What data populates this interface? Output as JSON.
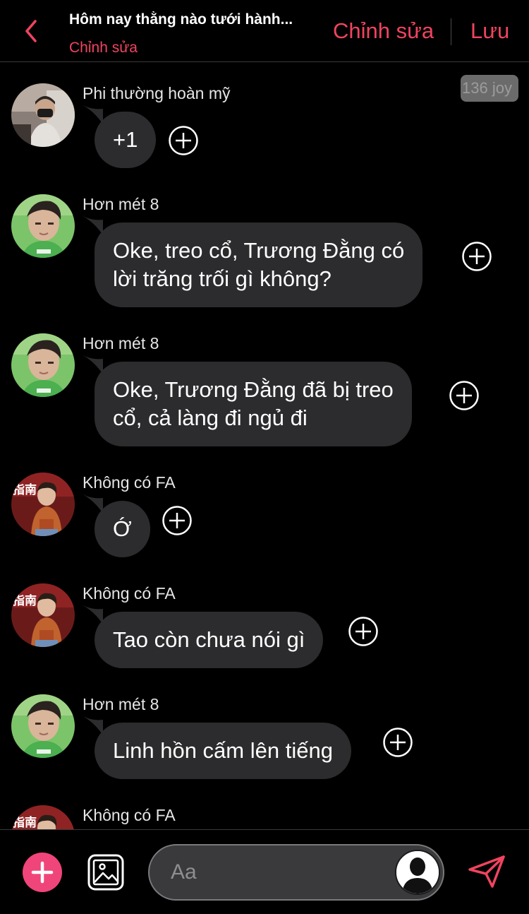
{
  "header": {
    "title": "Hôm nay thằng nào tưới hành...",
    "subtitle": "Chỉnh sửa",
    "edit_label": "Chỉnh sửa",
    "save_label": "Lưu",
    "back_icon": "chevron-left-icon"
  },
  "badge": "136 joy",
  "messages": [
    {
      "sender": "Phi thường hoàn mỹ",
      "lines": [
        "+1"
      ]
    },
    {
      "sender": "Hơn mét 8",
      "lines": [
        "Oke, treo cổ, Trương Đằng có",
        "lời trăng trối gì không?"
      ]
    },
    {
      "sender": "Hơn mét 8",
      "lines": [
        "Oke, Trương Đằng đã bị treo",
        "cổ, cả làng đi ngủ đi"
      ]
    },
    {
      "sender": "Không có FA",
      "lines": [
        "Ớ"
      ]
    },
    {
      "sender": "Không có FA",
      "lines": [
        "Tao còn chưa nói gì"
      ]
    },
    {
      "sender": "Hơn mét 8",
      "lines": [
        "Linh hồn cấm lên tiếng"
      ]
    },
    {
      "sender": "Không có FA",
      "lines": []
    }
  ],
  "input": {
    "placeholder": "Aa"
  },
  "colors": {
    "accent": "#f0445f",
    "add_button": "#f0457a",
    "bubble": "#2c2c2e",
    "background": "#000000"
  },
  "icons": {
    "add": "plus-icon",
    "image": "image-icon",
    "send": "send-icon",
    "react": "add-reaction-icon",
    "voice": "user-avatar-icon"
  }
}
